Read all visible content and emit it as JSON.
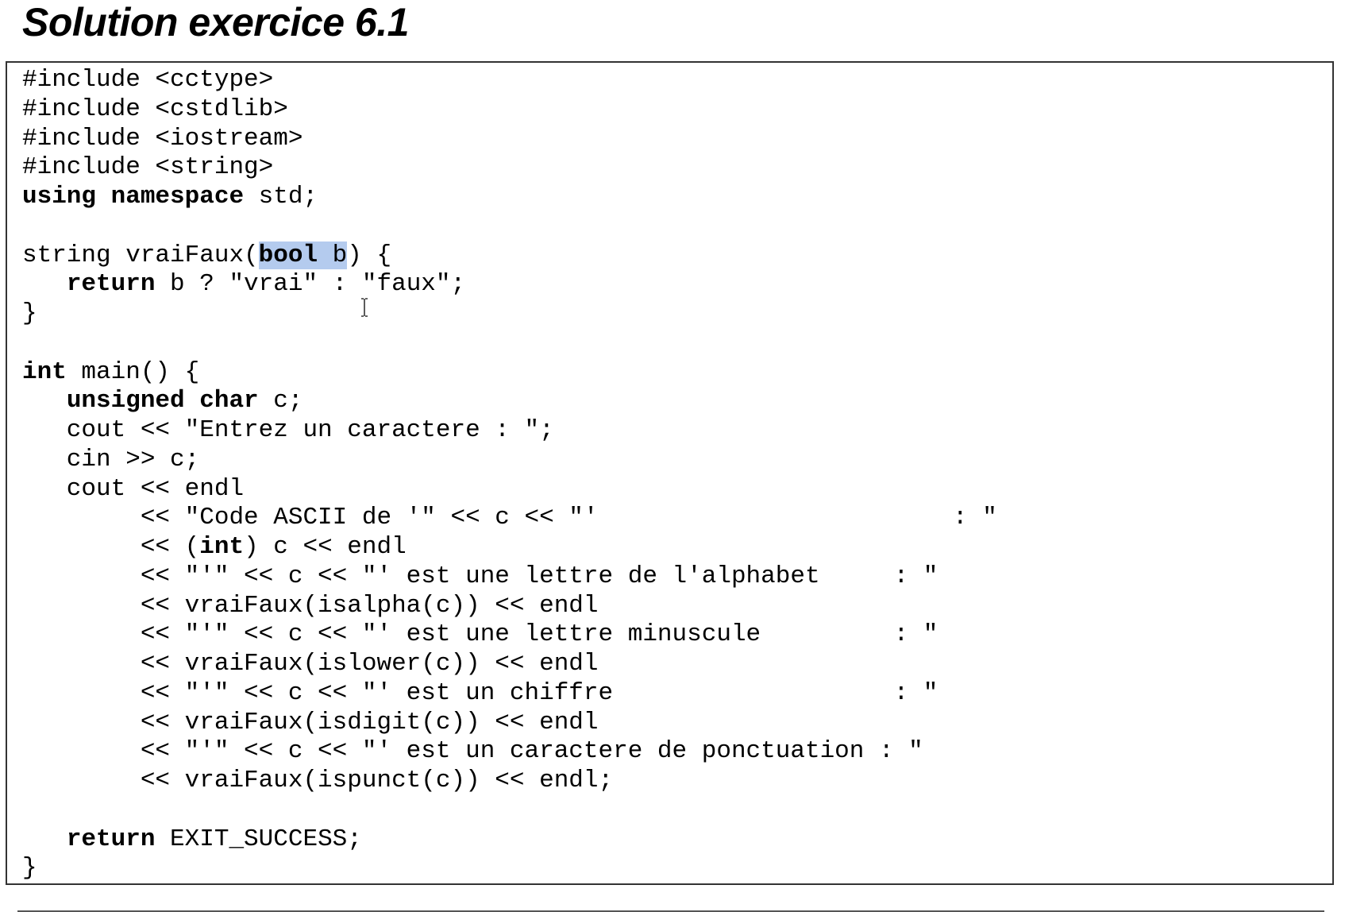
{
  "page": {
    "title": "Solution exercice 6.1"
  },
  "code": {
    "selection_color": "#b4cbee",
    "lines": [
      "#include <cctype>",
      "#include <cstdlib>",
      "#include <iostream>",
      "#include <string>",
      "using namespace std;",
      "",
      "string vraiFaux(bool b) {",
      "   return b ? \"vrai\" : \"faux\";",
      "}",
      "",
      "int main() {",
      "   unsigned char c;",
      "   cout << \"Entrez un caractere : \";",
      "   cin >> c;",
      "   cout << endl",
      "        << \"Code ASCII de '\" << c << \"'                        : \"",
      "        << (int) c << endl",
      "        << \"'\" << c << \"' est une lettre de l'alphabet     : \"",
      "        << vraiFaux(isalpha(c)) << endl",
      "        << \"'\" << c << \"' est une lettre minuscule         : \"",
      "        << vraiFaux(islower(c)) << endl",
      "        << \"'\" << c << \"' est un chiffre                   : \"",
      "        << vraiFaux(isdigit(c)) << endl",
      "        << \"'\" << c << \"' est un caractere de ponctuation : \"",
      "        << vraiFaux(ispunct(c)) << endl;",
      "",
      "   return EXIT_SUCCESS;",
      "}"
    ]
  }
}
